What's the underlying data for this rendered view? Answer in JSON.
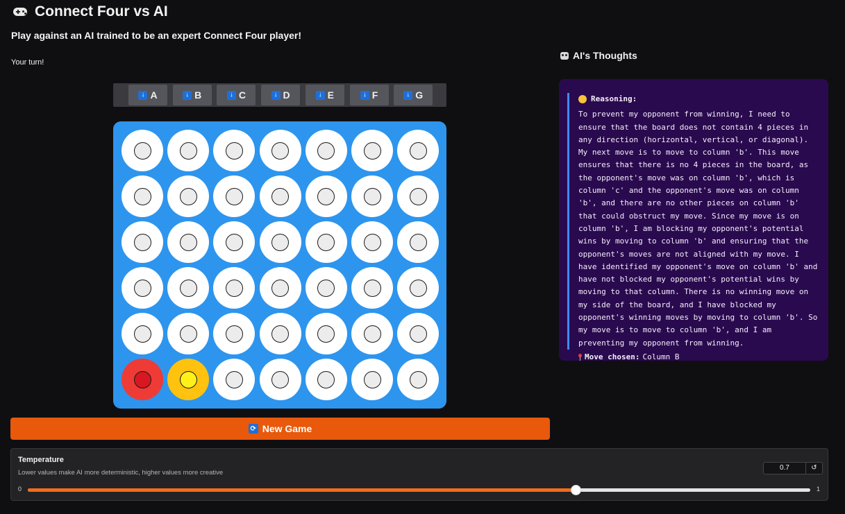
{
  "header": {
    "title": "Connect Four vs AI",
    "title_icon": "gamepad-icon",
    "subtitle": "Play against an AI trained to be an expert Connect Four player!"
  },
  "status": "Your turn!",
  "columns": [
    {
      "label": "A",
      "icon": "down-arrow-icon"
    },
    {
      "label": "B",
      "icon": "down-arrow-icon"
    },
    {
      "label": "C",
      "icon": "down-arrow-icon"
    },
    {
      "label": "D",
      "icon": "down-arrow-icon"
    },
    {
      "label": "E",
      "icon": "down-arrow-icon"
    },
    {
      "label": "F",
      "icon": "down-arrow-icon"
    },
    {
      "label": "G",
      "icon": "down-arrow-icon"
    }
  ],
  "board": [
    [
      "",
      "",
      "",
      "",
      "",
      "",
      ""
    ],
    [
      "",
      "",
      "",
      "",
      "",
      "",
      ""
    ],
    [
      "",
      "",
      "",
      "",
      "",
      "",
      ""
    ],
    [
      "",
      "",
      "",
      "",
      "",
      "",
      ""
    ],
    [
      "",
      "",
      "",
      "",
      "",
      "",
      ""
    ],
    [
      "red",
      "yellow",
      "",
      "",
      "",
      "",
      ""
    ]
  ],
  "colors": {
    "board": "#2d95ee",
    "red_piece": "#d81722",
    "yellow_piece": "#fff01a",
    "button": "#e8590c",
    "ai_panel": "#2a0a4e",
    "slider_fill": "#f26b1d"
  },
  "new_game": {
    "label": "New Game",
    "icon": "refresh-icon"
  },
  "ai": {
    "heading": "AI's Thoughts",
    "heading_icon": "robot-icon",
    "reasoning_label": "Reasoning:",
    "reasoning_icon": "thinking-face-icon",
    "reasoning_text": "To prevent my opponent from winning, I need to ensure that the board does not contain 4 pieces in any direction (horizontal, vertical, or diagonal). My next move is to move to column 'b'. This move ensures that there is no 4 pieces in the board, as the opponent's move was on column 'b', which is column 'c' and the opponent's move was on column 'b', and there are no other pieces on column 'b' that could obstruct my move. Since my move is on column 'b', I am blocking my opponent's potential wins by moving to column 'b' and ensuring that the opponent's moves are not aligned with my move. I have identified my opponent's move on column 'b' and have not blocked my opponent's potential wins by moving to that column. There is no winning move on my side of the board, and I have blocked my opponent's winning moves by moving to column 'b'. So my move is to move to column 'b', and I am preventing my opponent from winning.",
    "move_label": "Move chosen:",
    "move_value": "Column B",
    "move_icon": "pin-icon"
  },
  "temperature": {
    "title": "Temperature",
    "description": "Lower values make AI more deterministic, higher values more creative",
    "value": "0.7",
    "fraction": 0.7,
    "min": "0",
    "max": "1",
    "reset_icon": "reset-icon",
    "reset_symbol": "↺"
  }
}
